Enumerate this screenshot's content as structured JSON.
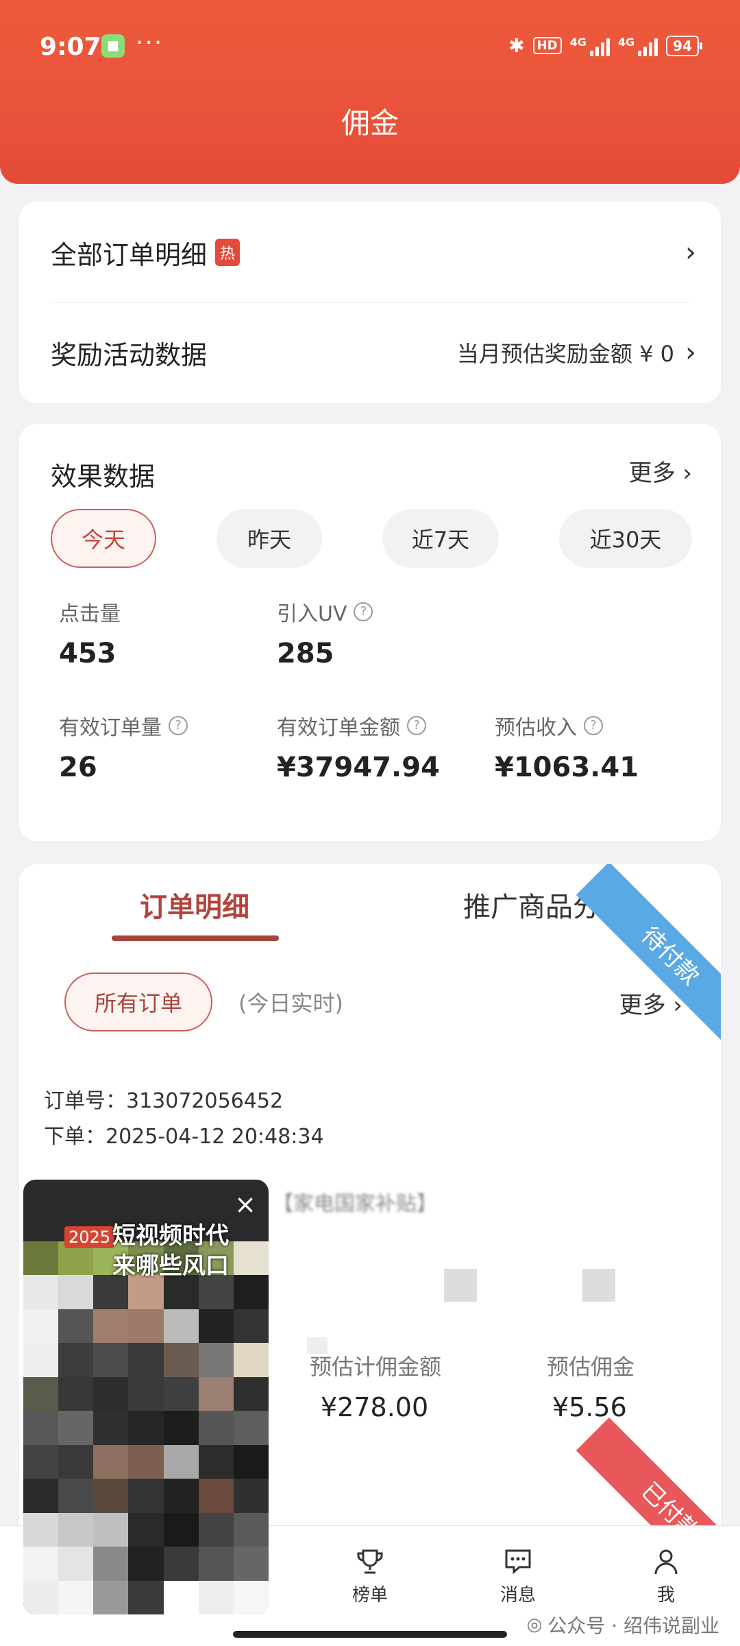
{
  "status_bar": {
    "time": "9:07",
    "battery": "94",
    "network": "4G",
    "hd": "HD"
  },
  "header": {
    "title": "佣金"
  },
  "links": {
    "all_orders": {
      "label": "全部订单明细",
      "badge": "热"
    },
    "reward_data": {
      "label": "奖励活动数据",
      "value": "当月预估奖励金额 ¥ 0"
    }
  },
  "effect": {
    "title": "效果数据",
    "more": "更多 ›",
    "periods": [
      "今天",
      "昨天",
      "近7天",
      "近30天"
    ],
    "active_period": 0,
    "metrics": {
      "clicks": {
        "label": "点击量",
        "value": "453"
      },
      "uv": {
        "label": "引入UV",
        "value": "285"
      },
      "valid_orders": {
        "label": "有效订单量",
        "value": "26"
      },
      "valid_amount": {
        "label": "有效订单金额",
        "value": "¥37947.94"
      },
      "est_income": {
        "label": "预估收入",
        "value": "¥1063.41"
      }
    }
  },
  "orders": {
    "tabs": [
      "订单明细",
      "推广商品分析"
    ],
    "filter": "所有订单",
    "realtime": "(今日实时)",
    "more": "更多 ›",
    "item": {
      "status": "待付款",
      "order_no": "订单号：313072056452",
      "placed": "下单：2025-04-12 20:48:34",
      "product": "【家电国家补贴】",
      "est_base_label": "预估计佣金额",
      "est_base_value": "¥278.00",
      "est_comm_label": "预估佣金",
      "est_comm_value": "¥5.56"
    },
    "next_status": "已付款"
  },
  "video": {
    "year": "2025",
    "title_line1": "短视频时代",
    "title_line2": "来哪些风口",
    "close": "×"
  },
  "nav": {
    "rank": "榜单",
    "messages": "消息",
    "me": "我"
  },
  "watermark": "公众号 · 绍伟说副业"
}
